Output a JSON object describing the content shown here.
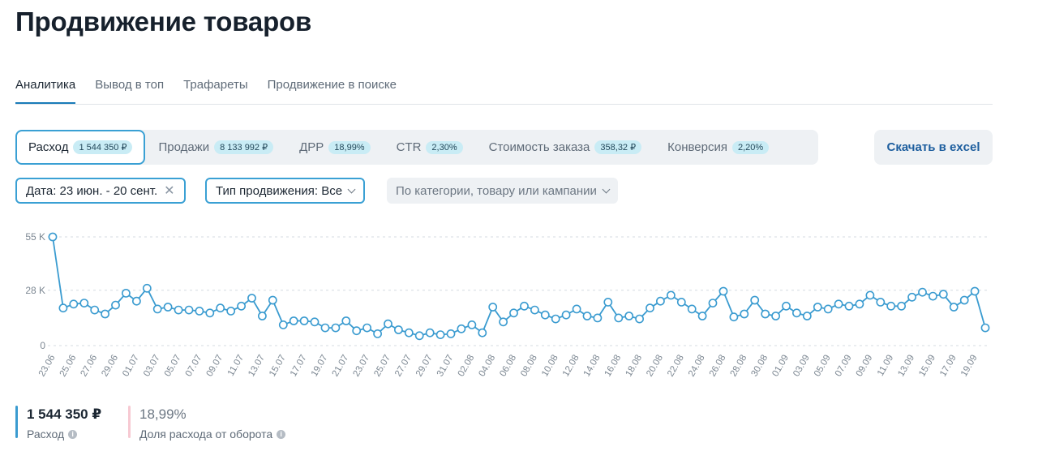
{
  "page": {
    "title": "Продвижение товаров"
  },
  "tabs": [
    {
      "label": "Аналитика"
    },
    {
      "label": "Вывод в топ"
    },
    {
      "label": "Трафареты"
    },
    {
      "label": "Продвижение в поиске"
    }
  ],
  "metrics": [
    {
      "label": "Расход",
      "value": "1 544 350 ₽"
    },
    {
      "label": "Продажи",
      "value": "8 133 992 ₽"
    },
    {
      "label": "ДРР",
      "value": "18,99%"
    },
    {
      "label": "CTR",
      "value": "2,30%"
    },
    {
      "label": "Стоимость заказа",
      "value": "358,32 ₽"
    },
    {
      "label": "Конверсия",
      "value": "2,20%"
    }
  ],
  "actions": {
    "excel_label": "Скачать в excel"
  },
  "filters": {
    "date": "Дата: 23 июн. - 20 сент.",
    "type": "Тип продвижения: Все",
    "search": "По категории, товару или кампании"
  },
  "summary": {
    "spend_value": "1 544 350 ₽",
    "spend_label": "Расход",
    "share_value": "18,99%",
    "share_label": "Доля расхода от оборота"
  },
  "colors": {
    "accent": "#3aa0d4",
    "line": "#3a9bd0",
    "badge": "#c9ecf5",
    "secondary_bar": "#f7c9d2"
  },
  "chart_data": {
    "type": "line",
    "ylim": [
      0,
      55000
    ],
    "yticks": [
      0,
      28000,
      55000
    ],
    "ytick_labels": [
      "0",
      "28 K",
      "55 K"
    ],
    "x_start": "23.06",
    "x_end": "20.09",
    "x_ticks": [
      "23.06",
      "25.06",
      "27.06",
      "29.06",
      "01.07",
      "03.07",
      "05.07",
      "07.07",
      "09.07",
      "11.07",
      "13.07",
      "15.07",
      "17.07",
      "19.07",
      "21.07",
      "23.07",
      "25.07",
      "27.07",
      "29.07",
      "31.07",
      "02.08",
      "04.08",
      "06.08",
      "08.08",
      "10.08",
      "12.08",
      "14.08",
      "16.08",
      "18.08",
      "20.08",
      "22.08",
      "24.08",
      "26.08",
      "28.08",
      "30.08",
      "01.09",
      "03.09",
      "05.09",
      "07.09",
      "09.09",
      "11.09",
      "13.09",
      "15.09",
      "17.09",
      "19.09"
    ],
    "values": [
      55000,
      19000,
      21000,
      21500,
      18000,
      16000,
      20500,
      26500,
      22500,
      29000,
      18500,
      19500,
      18000,
      18000,
      17500,
      16500,
      19000,
      17500,
      20000,
      24000,
      15000,
      23000,
      10500,
      12500,
      12500,
      12000,
      9000,
      9000,
      12500,
      7500,
      9000,
      6000,
      11000,
      8000,
      6500,
      5000,
      6500,
      5500,
      6000,
      8500,
      10500,
      6500,
      19500,
      12000,
      16500,
      20000,
      18000,
      15500,
      13500,
      15500,
      18500,
      15000,
      14000,
      22000,
      14000,
      15000,
      13500,
      19000,
      22500,
      25500,
      22000,
      18500,
      15000,
      21500,
      27500,
      14500,
      16000,
      23000,
      16000,
      15000,
      20000,
      16500,
      15000,
      19500,
      18500,
      21000,
      20000,
      21000,
      25500,
      22000,
      20000,
      20000,
      24500,
      27000,
      25000,
      26000,
      19500,
      23000,
      27500,
      9000
    ]
  }
}
